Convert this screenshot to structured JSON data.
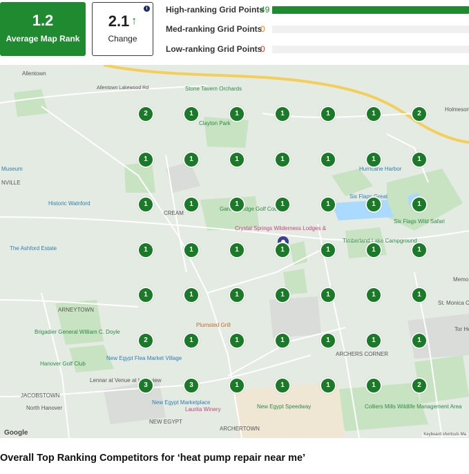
{
  "stats": {
    "avg_rank_value": "1.2",
    "avg_rank_label": "Average Map Rank",
    "change_value": "2.1",
    "change_label": "Change"
  },
  "grid_points": [
    {
      "label": "High-ranking Grid Points",
      "count": "49",
      "count_color": "#1f8a2f",
      "fill_fraction": 1.0
    },
    {
      "label": "Med-ranking Grid Points",
      "count": "0",
      "count_color": "#e08a1e",
      "fill_fraction": 0
    },
    {
      "label": "Low-ranking Grid Points",
      "count": "0",
      "count_color": "#d9342b",
      "fill_fraction": 0
    }
  ],
  "map": {
    "place_labels": [
      "Allentown",
      "Stone Tavern Orchards",
      "Holmeson",
      "Museum",
      "NVILLE",
      "Historic Walnford",
      "CREAM",
      "Garden Ridge Golf Course",
      "Crystal Springs Wilderness Lodges &",
      "Six Flags Great",
      "Six Flags Wild Safari",
      "The Ashford Estate",
      "Timberland Lake Campground",
      "Memo",
      "ARNEYTOWN",
      "St. Monica Catholic C",
      "Brigadier General William C. Doyle",
      "Plumsted Grill",
      "Hanover Golf Club",
      "New Egypt Flea Market Village",
      "Lennar at Venue at Longview",
      "ARCHERS CORNER",
      "JACOBSTOWN",
      "North Hanover",
      "New Egypt Marketplace",
      "Laurita Winery",
      "New Egypt Speedway",
      "Colliers Mills Wildlife Management Area",
      "NEW EGYPT",
      "ARCHERTOWN",
      "Clayton Park",
      "Hurricane Harbor",
      "Tor He",
      "Allentown Lakewood Rd",
      "Hurricane Harbor"
    ],
    "rank_grid": [
      [
        "2",
        "1",
        "1",
        "1",
        "1",
        "1",
        "2"
      ],
      [
        "1",
        "1",
        "1",
        "1",
        "1",
        "1",
        "1"
      ],
      [
        "1",
        "1",
        "1",
        "1",
        "1",
        "1",
        "1"
      ],
      [
        "1",
        "1",
        "1",
        "1",
        "1",
        "1",
        "1"
      ],
      [
        "1",
        "1",
        "1",
        "1",
        "1",
        "1",
        "1"
      ],
      [
        "2",
        "1",
        "1",
        "1",
        "1",
        "1",
        "1"
      ],
      [
        "3",
        "3",
        "1",
        "1",
        "1",
        "1",
        "2"
      ]
    ],
    "google_logo": "Google",
    "attribution": "Keyboard shortcuts   Ma"
  },
  "heading": "Overall Top Ranking Competitors for ‘heat pump repair near me’"
}
